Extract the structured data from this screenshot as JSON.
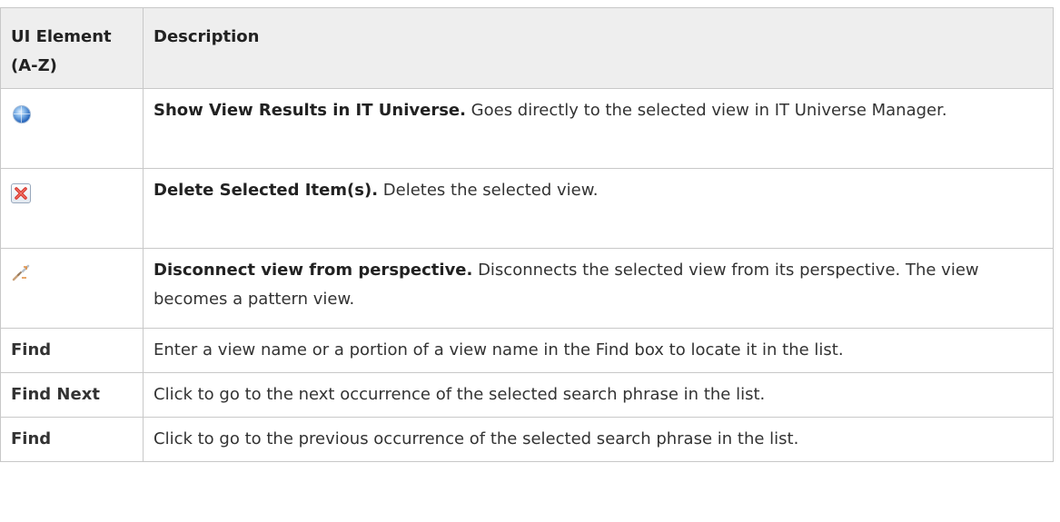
{
  "table": {
    "headers": {
      "element": "UI Element (A-Z)",
      "description": "Description"
    },
    "rows": [
      {
        "element_icon": "globe-icon",
        "title": "Show View Results in IT Universe.",
        "text": " Goes directly to the selected view in IT Universe Manager."
      },
      {
        "element_icon": "delete-icon",
        "title": "Delete Selected Item(s).",
        "text": " Deletes the selected view."
      },
      {
        "element_icon": "disconnect-icon",
        "title": "Disconnect view from perspective.",
        "text": " Disconnects the selected view from its perspective. The view becomes a pattern view."
      },
      {
        "element": "Find",
        "text": "Enter a view name or a portion of a view name in the Find box to locate it in the list."
      },
      {
        "element": "Find Next",
        "text": "Click to go to the next occurrence of the selected search phrase in the list."
      },
      {
        "element": "Find",
        "text": "Click to go to the previous occurrence of the selected search phrase in the list."
      }
    ]
  },
  "colors": {
    "header_bg": "#eeeeee",
    "border": "#c8c8c8",
    "delete_x": "#d9342b"
  }
}
